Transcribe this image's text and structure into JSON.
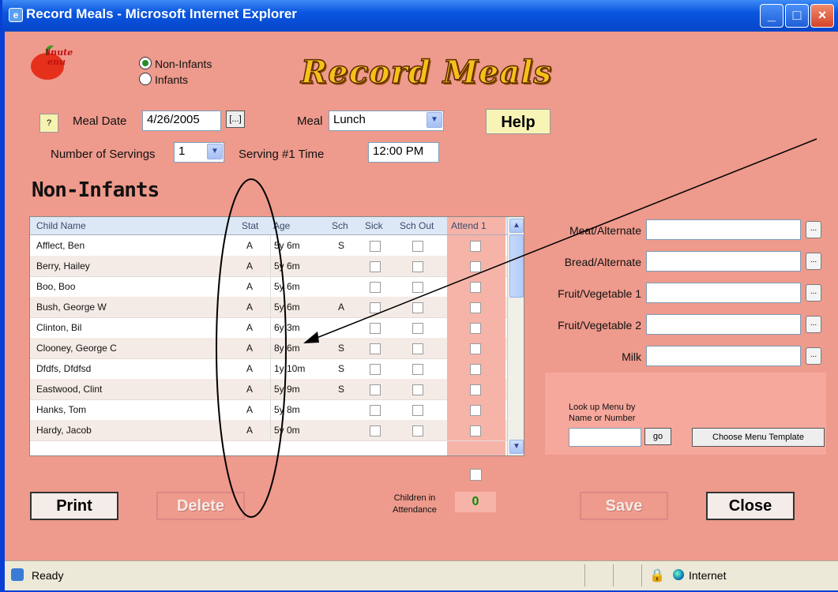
{
  "window": {
    "title": "Record Meals - Microsoft Internet Explorer"
  },
  "logo": {
    "line1": "inute",
    "line2": "enu"
  },
  "mode": {
    "options": [
      "Non-Infants",
      "Infants"
    ],
    "selected": "Non-Infants"
  },
  "page_title": "Record Meals",
  "help_small": "?",
  "meal_date": {
    "label": "Meal Date",
    "value": "4/26/2005",
    "picker": "[...]"
  },
  "meal": {
    "label": "Meal",
    "value": "Lunch"
  },
  "help_button": "Help",
  "servings": {
    "label": "Number of Servings",
    "value": "1"
  },
  "serving_time": {
    "label": "Serving #1 Time",
    "value": "12:00 PM"
  },
  "section_title": "Non-Infants",
  "grid": {
    "columns": [
      "Child Name",
      "Stat",
      "Age",
      "Sch",
      "Sick",
      "Sch Out",
      "Attend 1"
    ],
    "rows": [
      {
        "name": "Afflect, Ben",
        "stat": "A",
        "age": "5y 6m",
        "sch": "S"
      },
      {
        "name": "Berry, Hailey",
        "stat": "A",
        "age": "5y 6m",
        "sch": ""
      },
      {
        "name": "Boo, Boo",
        "stat": "A",
        "age": "5y 6m",
        "sch": ""
      },
      {
        "name": "Bush, George W",
        "stat": "A",
        "age": "5y 6m",
        "sch": "A"
      },
      {
        "name": "Clinton, Bil",
        "stat": "A",
        "age": "6y 3m",
        "sch": ""
      },
      {
        "name": "Clooney, George C",
        "stat": "A",
        "age": "8y 6m",
        "sch": "S"
      },
      {
        "name": "Dfdfs, Dfdfsd",
        "stat": "A",
        "age": "1y 10m",
        "sch": "S"
      },
      {
        "name": "Eastwood, Clint",
        "stat": "A",
        "age": "5y 9m",
        "sch": "S"
      },
      {
        "name": "Hanks, Tom",
        "stat": "A",
        "age": "5y 8m",
        "sch": ""
      },
      {
        "name": "Hardy, Jacob",
        "stat": "A",
        "age": "5y 0m",
        "sch": ""
      }
    ]
  },
  "components": {
    "labels": [
      "Meat/Alternate",
      "Bread/Alternate",
      "Fruit/Vegetable 1",
      "Fruit/Vegetable 2",
      "Milk"
    ],
    "button": "..."
  },
  "lookup": {
    "label_line1": "Look up Menu by",
    "label_line2": "Name or Number",
    "go": "go",
    "template": "Choose Menu Template"
  },
  "buttons": {
    "print": "Print",
    "delete": "Delete",
    "save": "Save",
    "close": "Close"
  },
  "attendance": {
    "label_line1": "Children in",
    "label_line2": "Attendance",
    "count": "0"
  },
  "status": {
    "text": "Ready",
    "zone": "Internet"
  }
}
